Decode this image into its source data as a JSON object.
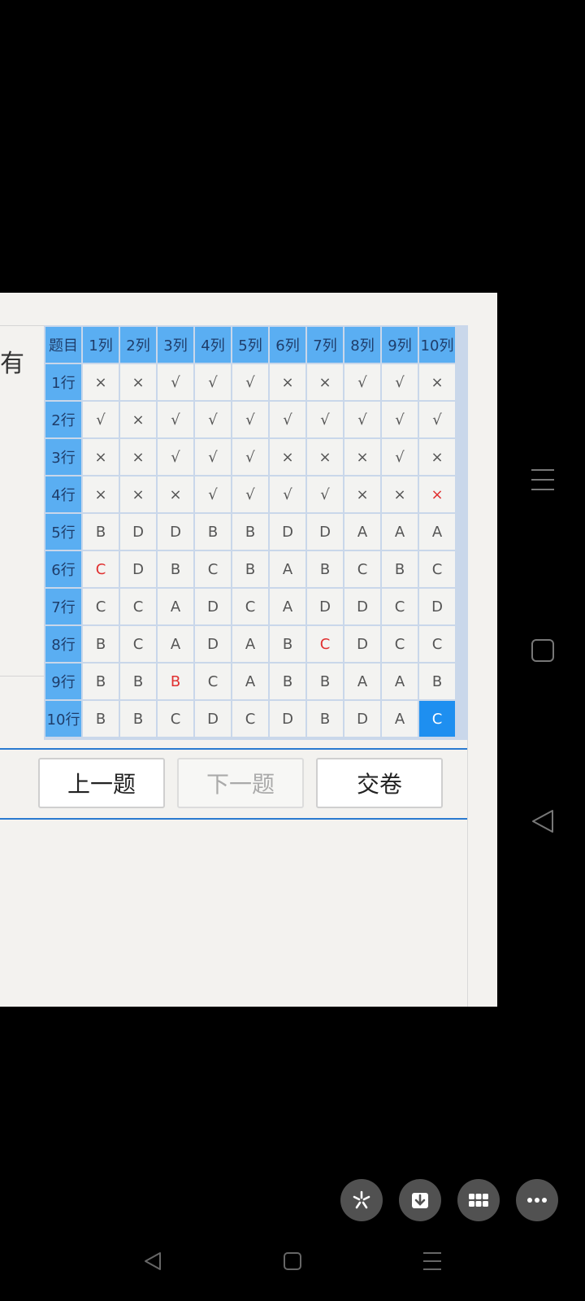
{
  "left_partial_text": "有",
  "grid": {
    "corner": "题目",
    "columns": [
      "1列",
      "2列",
      "3列",
      "4列",
      "5列",
      "6列",
      "7列",
      "8列",
      "9列",
      "10列"
    ],
    "rows": [
      {
        "label": "1行",
        "cells": [
          "×",
          "×",
          "√",
          "√",
          "√",
          "×",
          "×",
          "√",
          "√",
          "×"
        ],
        "red": []
      },
      {
        "label": "2行",
        "cells": [
          "√",
          "×",
          "√",
          "√",
          "√",
          "√",
          "√",
          "√",
          "√",
          "√"
        ],
        "red": []
      },
      {
        "label": "3行",
        "cells": [
          "×",
          "×",
          "√",
          "√",
          "√",
          "×",
          "×",
          "×",
          "√",
          "×"
        ],
        "red": []
      },
      {
        "label": "4行",
        "cells": [
          "×",
          "×",
          "×",
          "√",
          "√",
          "√",
          "√",
          "×",
          "×",
          "×"
        ],
        "red": [
          9
        ]
      },
      {
        "label": "5行",
        "cells": [
          "B",
          "D",
          "D",
          "B",
          "B",
          "D",
          "D",
          "A",
          "A",
          "A"
        ],
        "red": []
      },
      {
        "label": "6行",
        "cells": [
          "C",
          "D",
          "B",
          "C",
          "B",
          "A",
          "B",
          "C",
          "B",
          "C"
        ],
        "red": [
          0
        ]
      },
      {
        "label": "7行",
        "cells": [
          "C",
          "C",
          "A",
          "D",
          "C",
          "A",
          "D",
          "D",
          "C",
          "D"
        ],
        "red": []
      },
      {
        "label": "8行",
        "cells": [
          "B",
          "C",
          "A",
          "D",
          "A",
          "B",
          "C",
          "D",
          "C",
          "C"
        ],
        "red": [
          6
        ]
      },
      {
        "label": "9行",
        "cells": [
          "B",
          "B",
          "B",
          "C",
          "A",
          "B",
          "B",
          "A",
          "A",
          "B"
        ],
        "red": [
          2
        ]
      },
      {
        "label": "10行",
        "cells": [
          "B",
          "B",
          "C",
          "D",
          "C",
          "D",
          "B",
          "D",
          "A",
          "C"
        ],
        "red": []
      }
    ],
    "selected": {
      "row": 9,
      "col": 9
    }
  },
  "buttons": {
    "prev": "上一题",
    "next": "下一题",
    "submit": "交卷"
  },
  "side_icons": [
    "menu-icon",
    "square-icon",
    "back-triangle-icon"
  ],
  "fab_icons": [
    "sparkle-icon",
    "download-icon",
    "grid-icon",
    "more-icon"
  ],
  "navbar_icons": [
    "back-icon",
    "home-icon",
    "recents-icon"
  ]
}
